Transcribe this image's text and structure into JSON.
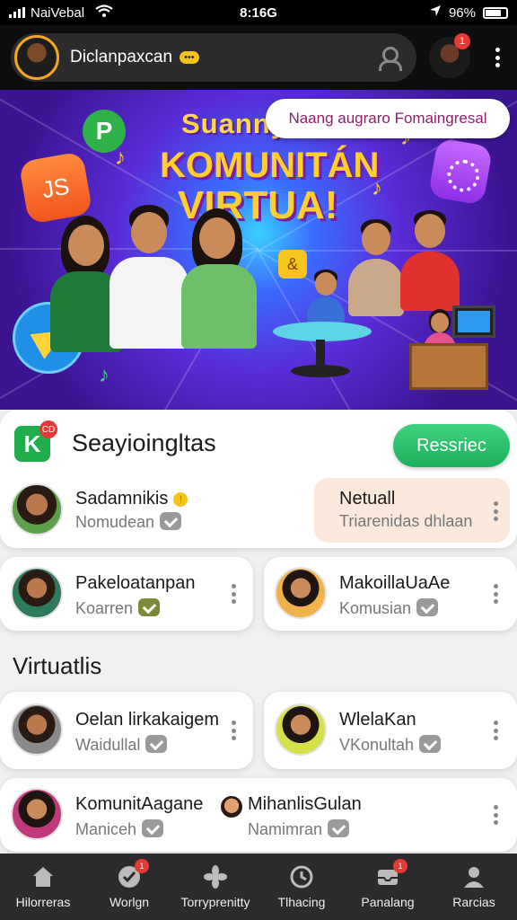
{
  "status_bar": {
    "carrier": "NaiVebal",
    "time": "8:16G",
    "battery": "96%"
  },
  "header": {
    "profile_name": "Diclanpaxcan",
    "emoji_badge": "•••",
    "avatar2_notif": "1"
  },
  "hero": {
    "pill_text": "Naang augraro Fomaingresal",
    "title_small": "Suanny",
    "title_line1": "KOMUNITÁN",
    "title_line2": "VIRTUA!",
    "bubble_p": "P",
    "bubble_js": "JS",
    "bubble_amp": "&"
  },
  "section1": {
    "badge": "CD",
    "icon_letter": "K",
    "title": "Seayioingltas",
    "register_label": "Ressriec",
    "cards": [
      {
        "title": "Sadamnikis",
        "subtitle": "Nomudean",
        "dot": "!"
      },
      {
        "title": "Netuall",
        "subtitle": "Triarenidas dhlaan"
      },
      {
        "title": "Pakeloatanpan",
        "subtitle": "Koarren"
      },
      {
        "title": "MakoillaUaAe",
        "subtitle": "Komusian"
      }
    ]
  },
  "section2": {
    "heading": "Virtuatlis",
    "cards": [
      {
        "title": "Oelan lirkakaigem",
        "subtitle": "Waidullal"
      },
      {
        "title": "WlelaKan",
        "subtitle": "VKonultah"
      },
      {
        "title": "KomunitAagane",
        "subtitle": "Maniceh"
      },
      {
        "title": "MihanlisGulan",
        "subtitle": "Namimran"
      }
    ]
  },
  "bottom_nav": [
    {
      "label": "Hilorreras",
      "icon": "home-icon"
    },
    {
      "label": "Worlgn",
      "icon": "check-circle-icon",
      "badge": "1"
    },
    {
      "label": "Torryprenitty",
      "icon": "fan-icon"
    },
    {
      "label": "Tlhacing",
      "icon": "clock-icon"
    },
    {
      "label": "Panalang",
      "icon": "inbox-icon",
      "badge": "1"
    },
    {
      "label": "Rarcias",
      "icon": "person-icon"
    }
  ],
  "colors": {
    "accent_green": "#1fae5c",
    "highlight": "#fde8dc",
    "notification_red": "#e53935",
    "hero_purple": "#5a2bd6"
  }
}
